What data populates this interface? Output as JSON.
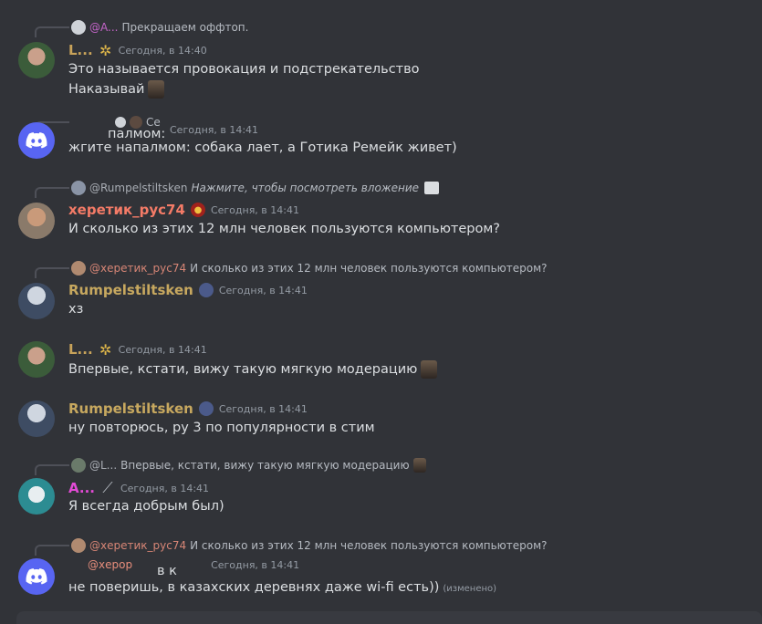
{
  "messages": [
    {
      "reply": {
        "author": "@A...",
        "text": "Прекращаем оффтоп."
      },
      "author": "L...",
      "time": "Сегодня, в 14:40",
      "lines": [
        "Это называется провокация и подстрекательство",
        "Наказывай"
      ]
    },
    {
      "reply": {
        "author": "",
        "text": "Се"
      },
      "author": "",
      "time": "Сегодня, в 14:41",
      "lines": [
        "палмом:",
        "жгите напалмом: собака лает, а Готика Ремейк живет)"
      ]
    },
    {
      "reply": {
        "author": "@Rumpelstiltsken",
        "text": "Нажмите, чтобы посмотреть вложение"
      },
      "author": "херетик_рус74",
      "time": "Сегодня, в 14:41",
      "lines": [
        "И сколько из этих 12 млн человек пользуются компьютером?"
      ]
    },
    {
      "reply": {
        "author": "@херетик_рус74",
        "text": "И сколько из этих 12 млн человек пользуются компьютером?"
      },
      "author": "Rumpelstiltsken",
      "time": "Сегодня, в 14:41",
      "lines": [
        "хз"
      ]
    },
    {
      "author": "L...",
      "time": "Сегодня, в 14:41",
      "lines": [
        "Впервые, кстати, вижу такую мягкую модерацию"
      ]
    },
    {
      "author": "Rumpelstiltsken",
      "time": "Сегодня, в 14:41",
      "lines": [
        "ну повторюсь, ру 3 по популярности в стим"
      ]
    },
    {
      "reply": {
        "author": "@L...",
        "text": "Впервые, кстати, вижу такую мягкую модерацию"
      },
      "author": "A...",
      "time": "Сегодня, в 14:41",
      "lines": [
        "Я всегда добрым был)"
      ]
    },
    {
      "reply": {
        "author": "@херетик_рус74",
        "text": "И сколько из этих 12 млн человек пользуются компьютером?"
      },
      "author": "@херор",
      "time": "Сегодня, в 14:41",
      "lines": [
        "в к",
        "не поверишь, в казахских деревнях даже wi-fi есть))"
      ],
      "edited": "(изменено)"
    }
  ],
  "colors": {
    "bg": "#313338",
    "name_green": "#c8a35a",
    "name_red": "#f47b67",
    "name_rumpel": "#c7a85f",
    "name_pink": "#e34bd6",
    "discord_blurple": "#5865f2"
  }
}
